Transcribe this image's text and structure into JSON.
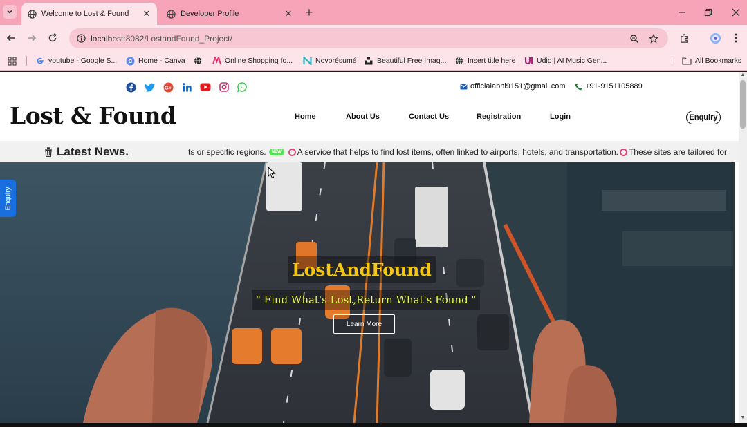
{
  "tabs": [
    {
      "title": "Welcome to Lost & Found",
      "active": true
    },
    {
      "title": "Developer Profile",
      "active": false
    }
  ],
  "address_bar": {
    "host": "localhost",
    "path": ":8082/LostandFound_Project/"
  },
  "bookmarks": [
    {
      "label": "youtube - Google S...",
      "icon": "google-icon"
    },
    {
      "label": "Home - Canva",
      "icon": "canva-icon"
    },
    {
      "label": "",
      "icon": "globe-icon"
    },
    {
      "label": "Online Shopping fo...",
      "icon": "myntra-icon"
    },
    {
      "label": "Novorésumé",
      "icon": "novoresume-icon"
    },
    {
      "label": "Beautiful Free Imag...",
      "icon": "unsplash-icon"
    },
    {
      "label": "Insert title here",
      "icon": "globe-icon"
    },
    {
      "label": "Udio | AI Music Gen...",
      "icon": "udio-icon"
    }
  ],
  "all_bookmarks_label": "All Bookmarks",
  "page": {
    "social_icons": [
      "facebook-icon",
      "twitter-icon",
      "google-plus-icon",
      "linkedin-icon",
      "youtube-icon",
      "instagram-icon",
      "whatsapp-icon"
    ],
    "email": "officialabhi9151@gmail.com",
    "phone": "+91-9151105889",
    "brand": "Lost & Found",
    "nav": [
      "Home",
      "About Us",
      "Contact Us",
      "Registration",
      "Login"
    ],
    "enquiry_button": "Enquiry",
    "news_title": "Latest News.",
    "ticker": {
      "part1": "ts or specific regions.",
      "badge": "NEW",
      "part2": "A service that helps to find lost items, often linked to airports, hotels, and transportation.",
      "part3": "These sites are tailored for"
    },
    "hero": {
      "title": "LostAndFound",
      "subtitle": "\" Find What's Lost,Return What's Found \"",
      "button": "Learn More"
    },
    "side_tab": "Enquiry"
  },
  "colors": {
    "tabstrip": "#f7a4b9",
    "toolbar": "#fde4ea",
    "hero_title": "#f5c518",
    "hero_subtitle": "#e9f560",
    "side_tab": "#1a6fe0"
  }
}
